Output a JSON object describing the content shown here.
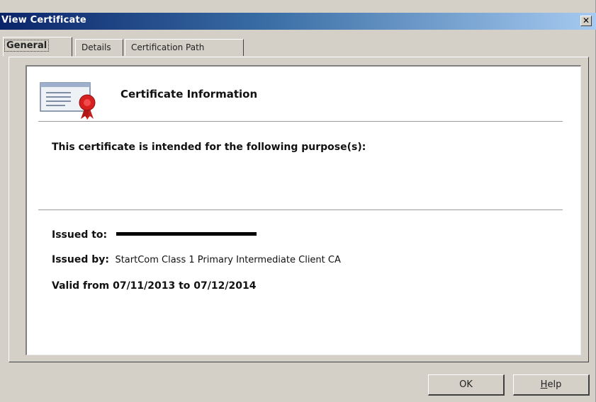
{
  "window": {
    "title": "View Certificate",
    "close_symbol": "✕"
  },
  "tabs": [
    {
      "label": "General",
      "active": true
    },
    {
      "label": "Details",
      "active": false
    },
    {
      "label": "Certification Path",
      "active": false
    }
  ],
  "general": {
    "icon": "certificate-icon",
    "section_title": "Certificate Information",
    "purpose_heading": "This certificate is intended for the following purpose(s):",
    "issued_to_label": "Issued to:",
    "issued_by_label": "Issued by:",
    "issued_by_value": "StartCom Class 1 Primary Intermediate Client CA",
    "valid_text": "Valid from 07/11/2013 to 07/12/2014"
  },
  "buttons": {
    "ok_label": "OK",
    "help_label_first": "H",
    "help_label_rest": "elp"
  },
  "colors": {
    "titlebar_start": "#0a246a",
    "titlebar_end": "#a6caf0",
    "dialog_face": "#d4d0c8",
    "seal_red": "#d81f1f"
  }
}
